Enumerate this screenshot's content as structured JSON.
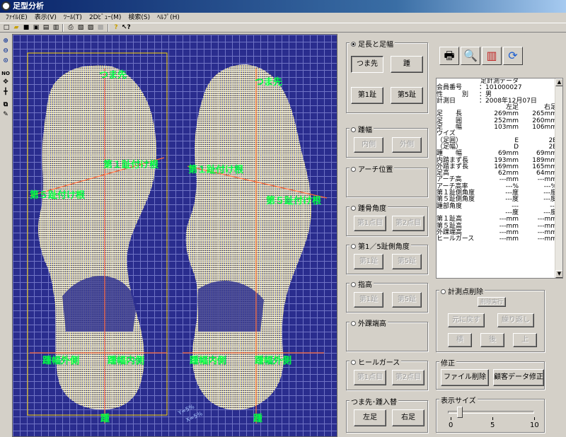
{
  "window": {
    "title": "足型分析"
  },
  "menu": [
    "ﾌｧｲﾙ(E)",
    "表示(V)",
    "ﾂｰﾙ(T)",
    "2Dﾋﾞｭｰ(M)",
    "検索(S)",
    "ﾍﾙﾌﾟ(H)"
  ],
  "toolbar_icons": [
    "new-icon",
    "open-icon",
    "save-icon",
    "save-as-icon",
    "report-icon",
    "export-icon",
    "print-icon",
    "print-preview-icon",
    "page-setup-icon",
    "disabled-icon",
    "help-icon",
    "context-help-icon"
  ],
  "left_tools": [
    "zoom-in-icon",
    "zoom-out-icon",
    "zoom-fit-icon",
    "NO",
    "move-icon",
    "crosshair-icon",
    "copy-icon",
    "edit-icon"
  ],
  "viewer": {
    "labels": {
      "left_toe": "つま先",
      "right_toe": "つま先",
      "left_mp1": "第１趾付け根",
      "right_mp1": "第１趾付け根",
      "left_mp5": "第５趾付け根",
      "right_mp5": "第５趾付け根",
      "left_heel_outer": "踵幅外側",
      "left_heel_inner": "踵幅内側",
      "right_heel_inner": "踵幅内側",
      "right_heel_outer": "踵幅外側",
      "left_heel": "踵",
      "right_heel": "踵",
      "axis_y": "Y=5%",
      "axis_x": "X=5%"
    },
    "colors": {
      "grid_bg": "#2a2d8e",
      "grid_line": "#6f73c4",
      "point_cloud": "#fffbe0",
      "guide_line": "#ff6a3a",
      "label": "#00ff44",
      "frame": "#ffd700"
    }
  },
  "controls": {
    "foot_length_width": {
      "label": "足長と足幅",
      "selected": true,
      "buttons": [
        "つま先",
        "踵",
        "第1趾",
        "第5趾"
      ]
    },
    "heel_width": {
      "label": "踵幅",
      "buttons": [
        "内側",
        "外側"
      ]
    },
    "arch": {
      "label": "アーチ位置"
    },
    "heel_bone_angle": {
      "label": "踵骨角度",
      "buttons": [
        "第1点目",
        "第2点目"
      ]
    },
    "toe_side_angle": {
      "label": "第1／5趾側角度",
      "buttons": [
        "第1趾",
        "第5趾"
      ]
    },
    "toe_height": {
      "label": "指高",
      "buttons": [
        "第1趾",
        "第5趾"
      ]
    },
    "malleolus": {
      "label": "外踝端高"
    },
    "heel_girth": {
      "label": "ヒールガース",
      "buttons": [
        "第1点目",
        "第2点目"
      ]
    },
    "swap": {
      "label": "つま先･踵入替",
      "buttons": [
        "左足",
        "右足"
      ]
    }
  },
  "right_toolbar_icons": [
    "print-icon",
    "preview-icon",
    "scan-icon",
    "refresh-icon"
  ],
  "measurement": {
    "title": "足計測データ",
    "member_no_label": "会員番号",
    "member_no": "101000027",
    "sex_label": "性　　　別",
    "sex": "男",
    "date_label": "計測日",
    "date": "2008年12月07日",
    "col_left": "左足",
    "col_right": "右足",
    "rows": [
      [
        "足　　長",
        "269mm",
        "265mm"
      ],
      [
        "足　　囲",
        "252mm",
        "260mm"
      ],
      [
        "足　　幅",
        "103mm",
        "106mm"
      ],
      [
        "ウイズ",
        "",
        ""
      ],
      [
        "（足囲）",
        "E",
        "2E"
      ],
      [
        "（足幅）",
        "D",
        "2E"
      ],
      [
        "踵　　幅",
        "69mm",
        "69mm"
      ],
      [
        "内踏まず長",
        "193mm",
        "189mm"
      ],
      [
        "外踏まず長",
        "169mm",
        "165mm"
      ],
      [
        "足高",
        "62mm",
        "64mm"
      ],
      [
        "アーチ高",
        "---mm",
        "---mm"
      ],
      [
        "アーチ高率",
        "---%",
        "---%"
      ],
      [
        "第１趾側角度",
        "---度",
        "---度"
      ],
      [
        "第５趾側角度",
        "---度",
        "---度"
      ],
      [
        "踵部角度",
        "---",
        "---"
      ],
      [
        "",
        "---度",
        "---度"
      ],
      [
        "第１趾高",
        "---mm",
        "---mm"
      ],
      [
        "第５趾高",
        "---mm",
        "---mm"
      ],
      [
        "外踝端高",
        "---mm",
        "---mm"
      ],
      [
        "ヒールガース",
        "---mm",
        "---mm"
      ]
    ]
  },
  "point_delete": {
    "label": "計測点削除",
    "exec": "削除実行",
    "undo": "元に戻す",
    "redo": "繰り返し",
    "dirs": [
      "横",
      "後",
      "上"
    ]
  },
  "fix": {
    "label": "修正",
    "delete_file": "ファイル削除",
    "edit_customer": "顧客データ修正"
  },
  "display_size": {
    "label": "表示サイズ",
    "min": "0",
    "mid": "5",
    "max": "10",
    "value": 1
  }
}
